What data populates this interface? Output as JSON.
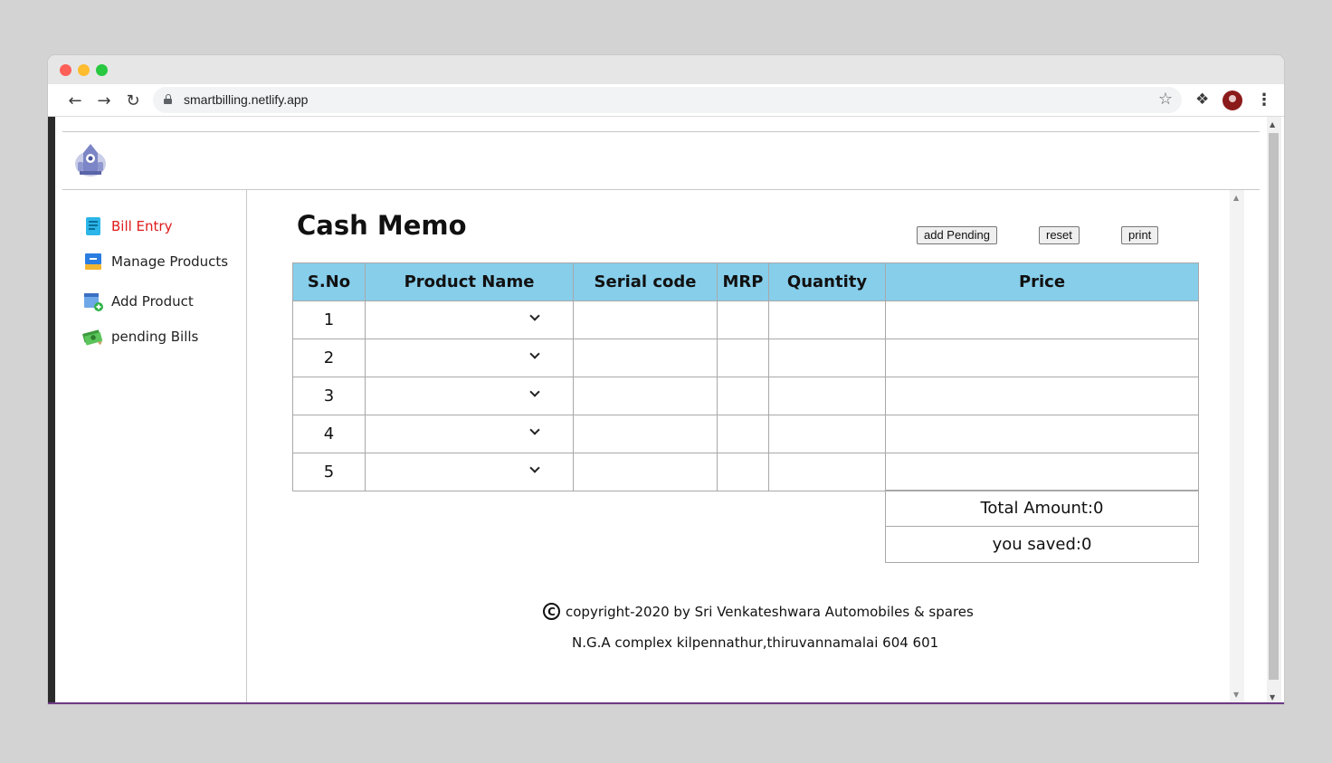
{
  "browser": {
    "url": "smartbilling.netlify.app"
  },
  "sidebar": {
    "items": [
      {
        "label": "Bill Entry",
        "icon": "bill-entry-icon",
        "active": true
      },
      {
        "label": "Manage Products",
        "icon": "manage-products-icon"
      },
      {
        "label": "Add Product",
        "icon": "add-product-icon"
      },
      {
        "label": "pending Bills",
        "icon": "pending-bills-icon"
      }
    ]
  },
  "main": {
    "title": "Cash Memo",
    "buttons": {
      "add_pending": "add Pending",
      "reset": "reset",
      "print": "print"
    },
    "table": {
      "headers": [
        "S.No",
        "Product Name",
        "Serial code",
        "MRP",
        "Quantity",
        "Price"
      ],
      "rows": [
        {
          "sno": "1",
          "product": "",
          "serial": "",
          "mrp": "",
          "qty": "",
          "price": ""
        },
        {
          "sno": "2",
          "product": "",
          "serial": "",
          "mrp": "",
          "qty": "",
          "price": ""
        },
        {
          "sno": "3",
          "product": "",
          "serial": "",
          "mrp": "",
          "qty": "",
          "price": ""
        },
        {
          "sno": "4",
          "product": "",
          "serial": "",
          "mrp": "",
          "qty": "",
          "price": ""
        },
        {
          "sno": "5",
          "product": "",
          "serial": "",
          "mrp": "",
          "qty": "",
          "price": ""
        }
      ]
    },
    "totals": {
      "total_amount": "Total Amount:0",
      "you_saved": "you saved:0"
    }
  },
  "footer": {
    "copyright_symbol": "C",
    "copyright": "copyright-2020 by Sri Venkateshwara Automobiles & spares",
    "address": "N.G.A complex kilpennathur,thiruvannamalai 604 601"
  },
  "colors": {
    "table_header_bg": "#87ceeb",
    "active_link": "#e01b1b"
  }
}
